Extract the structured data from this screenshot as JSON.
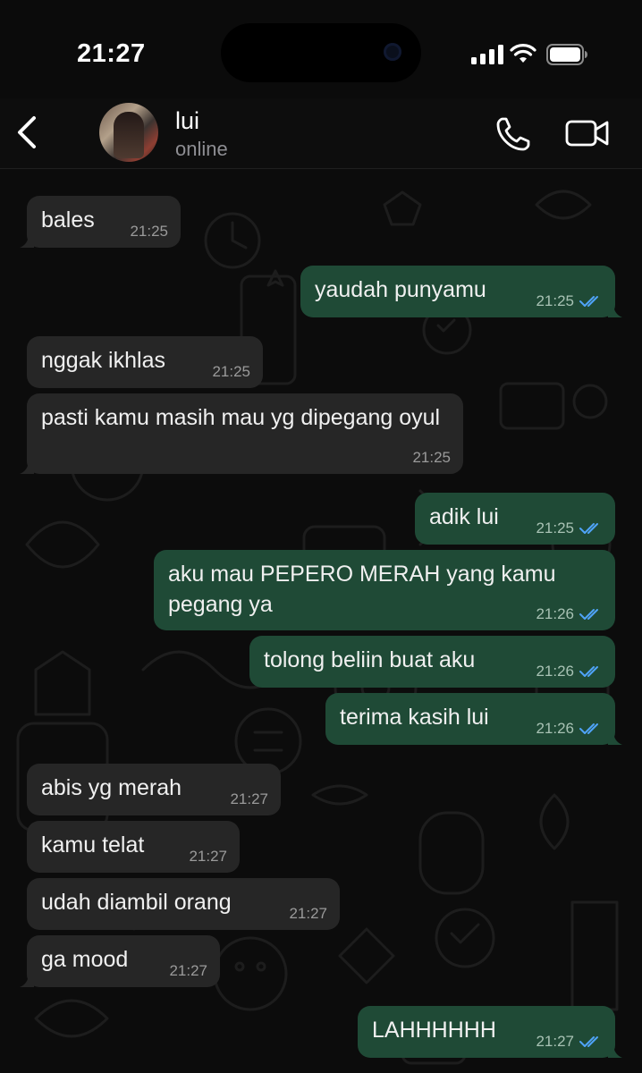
{
  "status_bar": {
    "time": "21:27"
  },
  "header": {
    "contact_name": "lui",
    "contact_status": "online"
  },
  "icons": {
    "back": "chevron-left-icon",
    "call": "phone-icon",
    "video": "video-camera-icon",
    "read_receipt": "double-check-icon"
  },
  "colors": {
    "incoming_bubble": "#262626",
    "outgoing_bubble": "#1f4a36",
    "read_ticks": "#4fa3f7",
    "background": "#0b0b0b"
  },
  "messages": [
    {
      "direction": "incoming",
      "text": "bales",
      "time": "21:25"
    },
    {
      "direction": "outgoing",
      "text": "yaudah punyamu",
      "time": "21:25",
      "read": true
    },
    {
      "direction": "incoming",
      "text": "nggak ikhlas",
      "time": "21:25"
    },
    {
      "direction": "incoming",
      "text": "pasti kamu masih mau yg dipegang oyul",
      "time": "21:25"
    },
    {
      "direction": "outgoing",
      "text": "adik lui",
      "time": "21:25",
      "read": true
    },
    {
      "direction": "outgoing",
      "text": "aku mau PEPERO MERAH yang kamu pegang ya",
      "time": "21:26",
      "read": true
    },
    {
      "direction": "outgoing",
      "text": "tolong beliin buat aku",
      "time": "21:26",
      "read": true
    },
    {
      "direction": "outgoing",
      "text": "terima kasih lui",
      "time": "21:26",
      "read": true
    },
    {
      "direction": "incoming",
      "text": "abis yg merah",
      "time": "21:27"
    },
    {
      "direction": "incoming",
      "text": "kamu telat",
      "time": "21:27"
    },
    {
      "direction": "incoming",
      "text": "udah diambil orang",
      "time": "21:27"
    },
    {
      "direction": "incoming",
      "text": "ga mood",
      "time": "21:27"
    },
    {
      "direction": "outgoing",
      "text": "LAHHHHHH",
      "time": "21:27",
      "read": true
    }
  ]
}
